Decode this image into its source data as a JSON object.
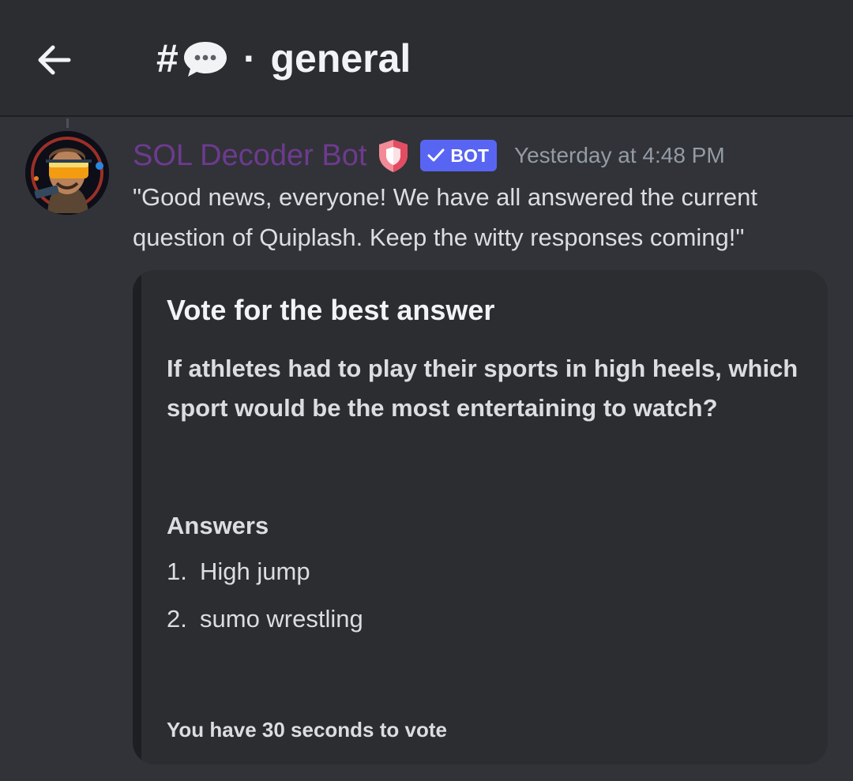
{
  "header": {
    "back_icon": "arrow-left-icon",
    "hash": "#",
    "channel_emoji": "speech-bubble-icon",
    "separator": "·",
    "channel_name": "general"
  },
  "message": {
    "username": "SOL Decoder Bot",
    "username_color": "#6e3a8f",
    "badge_icon": "shield-icon",
    "bot_tag": "BOT",
    "bot_tag_color": "#5865f2",
    "timestamp": "Yesterday at 4:48 PM",
    "text": "\"Good news, everyone! We have all answered the current question of Quiplash. Keep the witty responses coming!\""
  },
  "embed": {
    "title": "Vote for the best answer",
    "description": "If athletes had to play their sports in high heels, which sport would be the most entertaining to watch?",
    "answers_heading": "Answers",
    "answers": [
      {
        "num": "1.",
        "text": "High jump"
      },
      {
        "num": "2.",
        "text": "sumo wrestling"
      }
    ],
    "footer": "You have 30 seconds to vote"
  }
}
